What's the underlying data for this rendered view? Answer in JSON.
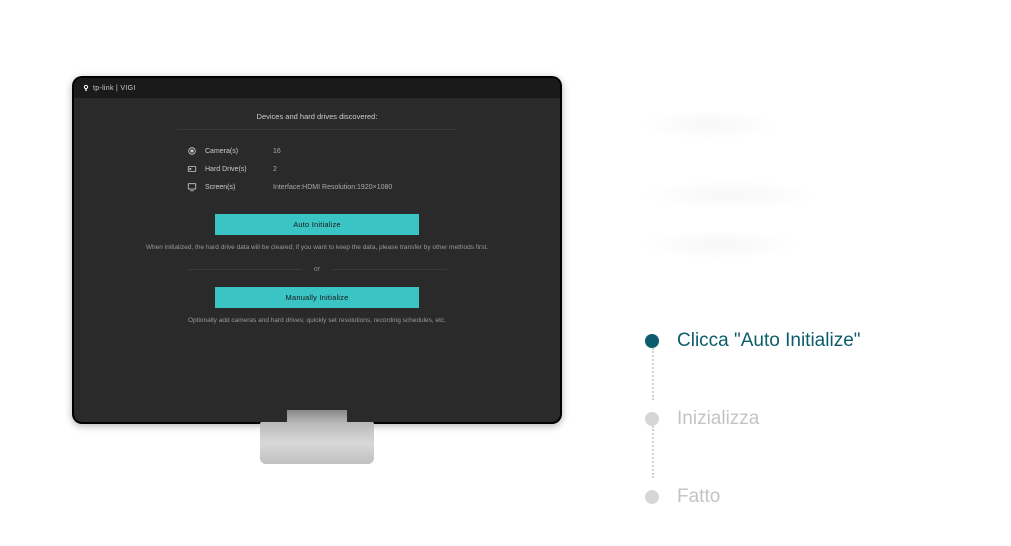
{
  "header": {
    "brand": "tp-link | VIGI"
  },
  "setup": {
    "heading": "Devices and hard drives discovered:",
    "devices": {
      "camera": {
        "label": "Camera(s)",
        "value": "16"
      },
      "harddrive": {
        "label": "Hard Drive(s)",
        "value": "2"
      },
      "screen": {
        "label": "Screen(s)",
        "value": "Interface:HDMI Resolution:1920×1080"
      }
    },
    "auto_btn": "Auto Initialize",
    "auto_caption": "When initialized, the hard drive data will be cleared; if you want to keep the data, please transfer by other methods first.",
    "or": "or",
    "manual_btn": "Manually Initialize",
    "manual_caption": "Optionally add cameras and hard drives; quickly set resolutions, recording schedules, etc."
  },
  "steps": [
    {
      "label": "Clicca \"Auto Initialize\"",
      "active": true
    },
    {
      "label": "Inizializza",
      "active": false
    },
    {
      "label": "Fatto",
      "active": false
    }
  ]
}
